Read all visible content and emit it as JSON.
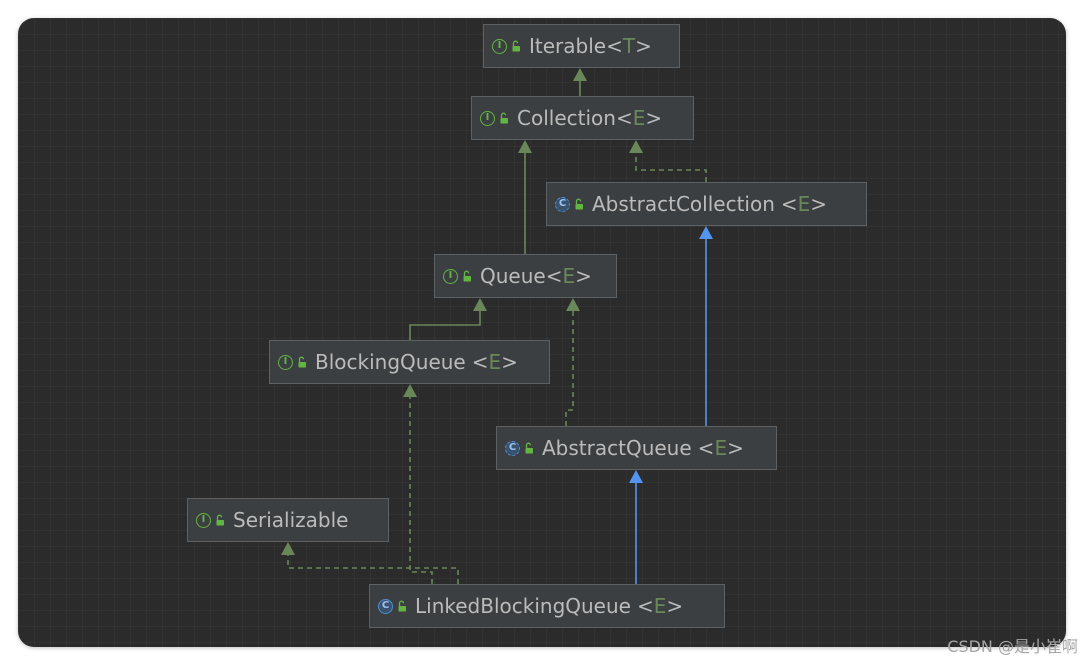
{
  "nodes": [
    {
      "id": "iterable",
      "kind": "interface",
      "kind_letter": "I",
      "name": "Iterable",
      "param_open": "<",
      "type_param": "T",
      "param_close": ">"
    },
    {
      "id": "collection",
      "kind": "interface",
      "kind_letter": "I",
      "name": "Collection",
      "param_open": "<",
      "type_param": "E",
      "param_close": ">"
    },
    {
      "id": "abstract-collection",
      "kind": "abstract class",
      "kind_letter": "C",
      "name": "AbstractCollection",
      "param_open": "<",
      "type_param": "E",
      "param_close": ">"
    },
    {
      "id": "queue",
      "kind": "interface",
      "kind_letter": "I",
      "name": "Queue",
      "param_open": "<",
      "type_param": "E",
      "param_close": ">"
    },
    {
      "id": "blocking-queue",
      "kind": "interface",
      "kind_letter": "I",
      "name": "BlockingQueue",
      "param_open": "<",
      "type_param": "E",
      "param_close": ">"
    },
    {
      "id": "abstract-queue",
      "kind": "abstract class",
      "kind_letter": "C",
      "name": "AbstractQueue",
      "param_open": "<",
      "type_param": "E",
      "param_close": ">"
    },
    {
      "id": "serializable",
      "kind": "interface",
      "kind_letter": "I",
      "name": "Serializable",
      "param_open": "",
      "type_param": "",
      "param_close": ""
    },
    {
      "id": "linked-blocking-queue",
      "kind": "class",
      "kind_letter": "C",
      "name": "LinkedBlockingQueue",
      "param_open": "<",
      "type_param": "E",
      "param_close": ">"
    }
  ],
  "edges": [
    {
      "from": "collection",
      "to": "iterable",
      "relation": "extends",
      "style": "solid",
      "color": "#6a8759"
    },
    {
      "from": "abstract-collection",
      "to": "collection",
      "relation": "implements",
      "style": "dashed",
      "color": "#6a8759"
    },
    {
      "from": "queue",
      "to": "collection",
      "relation": "extends",
      "style": "solid",
      "color": "#6a8759"
    },
    {
      "from": "blocking-queue",
      "to": "queue",
      "relation": "extends",
      "style": "solid",
      "color": "#6a8759"
    },
    {
      "from": "abstract-queue",
      "to": "queue",
      "relation": "implements",
      "style": "dashed",
      "color": "#6a8759"
    },
    {
      "from": "abstract-queue",
      "to": "abstract-collection",
      "relation": "extends",
      "style": "solid",
      "color": "#5394ec"
    },
    {
      "from": "linked-blocking-queue",
      "to": "abstract-queue",
      "relation": "extends",
      "style": "solid",
      "color": "#5394ec"
    },
    {
      "from": "linked-blocking-queue",
      "to": "blocking-queue",
      "relation": "implements",
      "style": "dashed",
      "color": "#6a8759"
    },
    {
      "from": "linked-blocking-queue",
      "to": "serializable",
      "relation": "implements",
      "style": "dashed",
      "color": "#6a8759"
    }
  ],
  "colors": {
    "background": "#2b2b2b",
    "node_fill": "#3c3f41",
    "node_border": "#5e6163",
    "text": "#bbbbbb",
    "type_param": "#6a8759",
    "interface_icon": "#62b543",
    "class_icon": "#4d8fd6",
    "lock_icon": "#62b543"
  },
  "icons": {
    "interface": "interface-icon",
    "class": "class-icon",
    "access": "unlocked-icon"
  },
  "watermark": "CSDN @是小崔啊"
}
